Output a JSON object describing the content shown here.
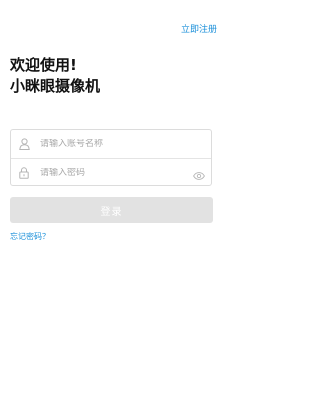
{
  "header": {
    "register_label": "立即注册"
  },
  "welcome": {
    "line1": "欢迎使用!",
    "line2": "小眯眼摄像机"
  },
  "form": {
    "account_placeholder": "请输入账号名称",
    "password_placeholder": "请输入密码",
    "account_icon": "user-icon",
    "password_icon": "lock-icon",
    "visibility_icon": "eye-icon"
  },
  "actions": {
    "login_label": "登录",
    "forgot_label": "忘记密码？"
  },
  "colors": {
    "link": "#1a8fd9",
    "button_disabled": "#e2e2e2",
    "border": "#dcdcdc"
  }
}
